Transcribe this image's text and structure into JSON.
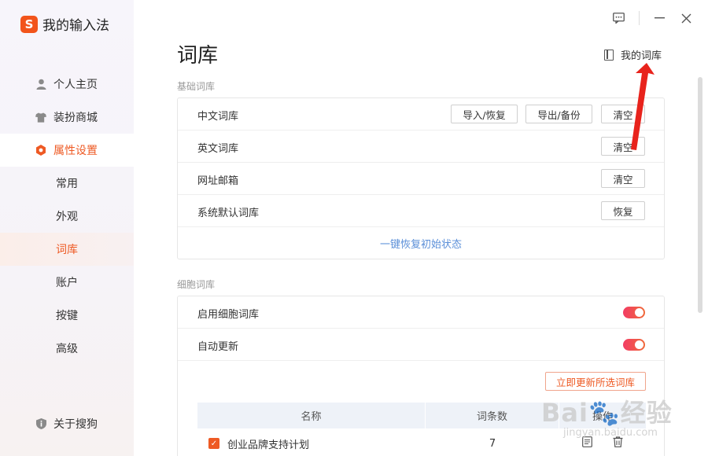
{
  "app": {
    "logo_letter": "S",
    "name": "我的输入法"
  },
  "sidebar": {
    "items": [
      {
        "label": "个人主页",
        "icon": "user-icon"
      },
      {
        "label": "装扮商城",
        "icon": "shirt-icon"
      },
      {
        "label": "属性设置",
        "icon": "hexagon-settings-icon"
      }
    ],
    "sub_items": [
      "常用",
      "外观",
      "词库",
      "账户",
      "按键",
      "高级"
    ],
    "about": {
      "label": "关于搜狗",
      "icon": "info-shield-icon"
    }
  },
  "window": {
    "controls": [
      "feedback-icon",
      "minimize-icon",
      "close-icon"
    ]
  },
  "page": {
    "title": "词库",
    "my_library": "我的词库"
  },
  "basic": {
    "section": "基础词库",
    "rows": [
      {
        "label": "中文词库",
        "buttons": [
          "导入/恢复",
          "导出/备份",
          "清空"
        ]
      },
      {
        "label": "英文词库",
        "buttons": [
          "清空"
        ]
      },
      {
        "label": "网址邮箱",
        "buttons": [
          "清空"
        ]
      },
      {
        "label": "系统默认词库",
        "buttons": [
          "恢复"
        ]
      }
    ],
    "restore_link": "一键恢复初始状态"
  },
  "cell": {
    "section": "细胞词库",
    "rows": [
      {
        "label": "启用细胞词库",
        "on": true
      },
      {
        "label": "自动更新",
        "on": true
      }
    ],
    "update_button": "立即更新所选词库",
    "table": {
      "headers": [
        "名称",
        "词条数",
        "操作"
      ],
      "rows": [
        {
          "name": "创业品牌支持计划",
          "count": "7",
          "checked": true
        }
      ]
    }
  },
  "watermark": {
    "main": "Bai🐾经验",
    "sub": "jingyan.baidu.com"
  },
  "colors": {
    "accent": "#ee5a24",
    "link": "#5b8fd8",
    "toggle_start": "#f23c64",
    "toggle_end": "#f06a3a",
    "annotation": "#e8231c"
  }
}
